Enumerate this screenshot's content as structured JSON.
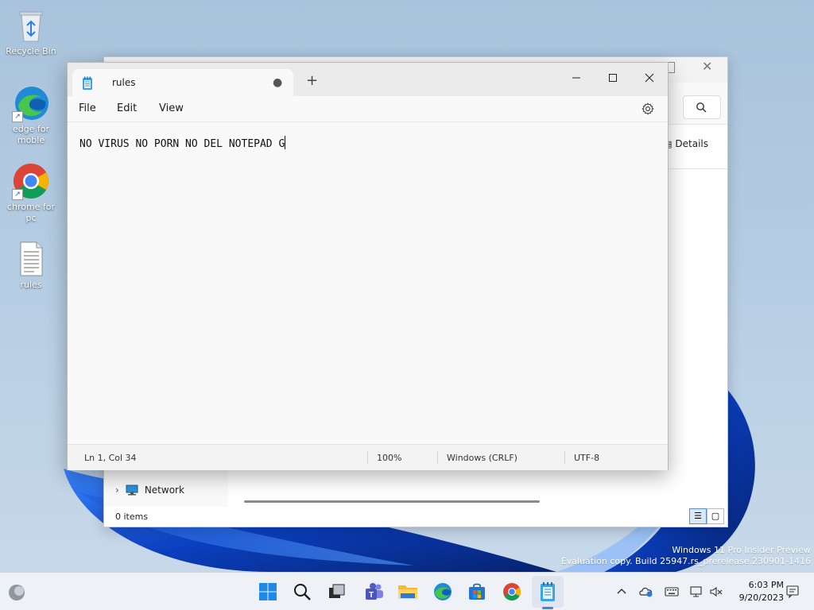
{
  "desktop": {
    "icons": [
      {
        "label": "Recycle Bin",
        "icon": "recycle-bin-icon"
      },
      {
        "label": "edge for\nmoble",
        "icon": "edge-icon"
      },
      {
        "label": "chrome for\npc",
        "icon": "chrome-icon"
      },
      {
        "label": "rules",
        "icon": "text-file-icon"
      }
    ]
  },
  "explorer": {
    "details_label": "Details",
    "nav_network": "Network",
    "status_items": "0 items"
  },
  "notepad": {
    "tab_title": "rules",
    "menu": {
      "file": "File",
      "edit": "Edit",
      "view": "View"
    },
    "content": "NO VIRUS NO PORN NO DEL NOTEPAD G",
    "status": {
      "position": "Ln 1, Col 34",
      "zoom": "100%",
      "line_ending": "Windows (CRLF)",
      "encoding": "UTF-8"
    }
  },
  "watermark": {
    "line1": "Windows 11 Pro Insider Preview",
    "line2": "Evaluation copy. Build 25947.rs_prerelease.230901-1416"
  },
  "taskbar": {
    "apps": [
      "start-icon",
      "search-icon",
      "task-view-icon",
      "teams-icon",
      "file-explorer-icon",
      "edge-icon",
      "store-icon",
      "chrome-icon",
      "notepad-icon"
    ],
    "clock_time": "6:03 PM",
    "clock_date": "9/20/2023"
  },
  "colors": {
    "accent": "#0078d4",
    "taskbar_bg": "#eef1f6",
    "bloom_dark": "#0a2a8c",
    "bloom_light": "#2f7bff"
  }
}
